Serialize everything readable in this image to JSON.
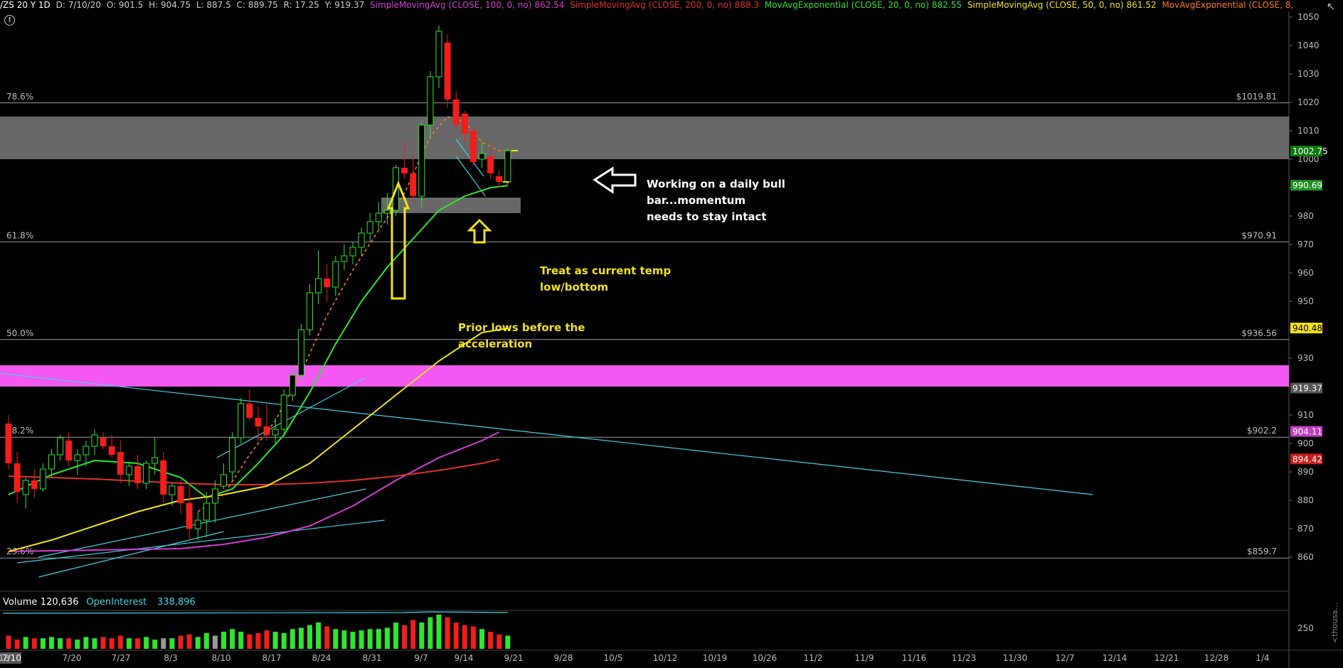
{
  "header": {
    "symbol": "/ZS 20 Y 1D",
    "fields": [
      {
        "label": "D: 7/10/20"
      },
      {
        "label": "O: 901.5"
      },
      {
        "label": "H: 904.75"
      },
      {
        "label": "L: 887.5"
      },
      {
        "label": "C: 889.75"
      },
      {
        "label": "R: 17.25"
      },
      {
        "label": "Y: 919.37"
      }
    ],
    "studies": [
      {
        "label": "SimpleMovingAvg (CLOSE, 100, 0, no)",
        "value": "862.54",
        "color": "#d43fd4"
      },
      {
        "label": "SimpleMovingAvg (CLOSE, 200, 0, no)",
        "value": "888.3",
        "color": "#e03131"
      },
      {
        "label": "MovAvgExponential (CLOSE, 20, 0, no)",
        "value": "882.55",
        "color": "#2ee62e"
      },
      {
        "label": "SimpleMovingAvg (CLOSE, 50, 0, no)",
        "value": "861.52",
        "color": "#f2e21b"
      },
      {
        "label": "MovAvgExponential (CLOSE, 8, 0,...",
        "value": "",
        "color": "#ff7a1a"
      }
    ]
  },
  "chart_data": {
    "type": "candlestick",
    "title": "/ZS 20 Y 1D",
    "x_ticks": [
      "7/10",
      "7/13",
      "7/20",
      "7/27",
      "8/3",
      "8/10",
      "8/17",
      "8/24",
      "8/31",
      "9/7",
      "9/14",
      "9/21",
      "9/28",
      "10/5",
      "10/12",
      "10/19",
      "10/26",
      "11/2",
      "11/9",
      "11/16",
      "11/23",
      "11/30",
      "12/7",
      "12/14",
      "12/21",
      "12/28",
      "1/4"
    ],
    "y_ticks": [
      860,
      870,
      880,
      890,
      900,
      910,
      920,
      930,
      940,
      950,
      960,
      970,
      980,
      990,
      1000,
      1010,
      1020,
      1030,
      1040,
      1050
    ],
    "ylim": [
      855,
      1055
    ],
    "candles": [
      [
        907,
        910,
        891,
        893
      ],
      [
        893,
        897,
        879,
        883
      ],
      [
        882,
        888,
        877,
        887
      ],
      [
        887,
        891,
        881,
        884
      ],
      [
        884,
        893,
        883,
        891
      ],
      [
        891,
        898,
        888,
        896
      ],
      [
        896,
        903,
        894,
        902
      ],
      [
        901,
        904,
        892,
        894
      ],
      [
        894,
        898,
        889,
        896
      ],
      [
        896,
        901,
        892,
        899
      ],
      [
        899,
        905,
        896,
        903
      ],
      [
        902,
        904,
        898,
        899
      ],
      [
        899,
        903,
        895,
        896
      ],
      [
        897,
        901,
        886,
        889
      ],
      [
        889,
        893,
        885,
        892
      ],
      [
        892,
        896,
        884,
        886
      ],
      [
        886,
        894,
        884,
        893
      ],
      [
        893,
        902,
        889,
        895
      ],
      [
        894,
        897,
        879,
        882
      ],
      [
        882,
        886,
        878,
        885
      ],
      [
        885,
        887,
        875,
        879
      ],
      [
        879,
        886,
        866,
        870
      ],
      [
        870,
        876,
        866,
        873
      ],
      [
        873,
        883,
        867,
        879
      ],
      [
        879,
        887,
        872,
        884
      ],
      [
        885,
        893,
        884,
        889
      ],
      [
        890,
        904,
        887,
        902
      ],
      [
        902,
        916,
        900,
        914
      ],
      [
        914,
        919,
        908,
        909
      ],
      [
        909,
        913,
        901,
        906
      ],
      [
        906,
        914,
        901,
        903
      ],
      [
        903,
        909,
        900,
        905
      ],
      [
        905,
        919,
        903,
        917
      ],
      [
        917,
        927,
        915,
        924
      ],
      [
        924,
        942,
        922,
        940
      ],
      [
        940,
        956,
        938,
        953
      ],
      [
        953,
        968,
        949,
        958
      ],
      [
        958,
        963,
        950,
        955
      ],
      [
        955,
        966,
        952,
        964
      ],
      [
        964,
        970,
        961,
        966
      ],
      [
        966,
        971,
        963,
        969
      ],
      [
        969,
        976,
        966,
        974
      ],
      [
        974,
        981,
        971,
        978
      ],
      [
        978,
        985,
        975,
        981
      ],
      [
        981,
        988,
        977,
        982
      ],
      [
        982,
        998,
        980,
        997
      ],
      [
        997,
        1006,
        993,
        995
      ],
      [
        995,
        1001,
        985,
        987
      ],
      [
        987,
        1013,
        983,
        1012
      ],
      [
        1012,
        1031,
        1007,
        1029
      ],
      [
        1029,
        1047,
        1025,
        1045
      ],
      [
        1041,
        1044,
        1018,
        1021
      ],
      [
        1021,
        1024,
        1011,
        1012
      ],
      [
        1016,
        1017,
        1006,
        1009
      ],
      [
        1010,
        1011,
        998,
        999
      ],
      [
        1000,
        1006,
        997,
        1002
      ],
      [
        1001,
        1004,
        993,
        995
      ],
      [
        994,
        996,
        990,
        992
      ],
      [
        992,
        1004,
        991,
        1003
      ]
    ],
    "series": [
      {
        "name": "SimpleMovingAvg (CLOSE, 100, 0, no)",
        "color": "#d43fd4",
        "x": [
          0,
          10,
          20,
          25,
          30,
          35,
          40,
          45,
          50,
          55,
          57
        ],
        "y": [
          862,
          862.5,
          863,
          864.5,
          867,
          871,
          878,
          887,
          895,
          901,
          904
        ]
      },
      {
        "name": "SimpleMovingAvg (CLOSE, 200, 0, no)",
        "color": "#e03131",
        "x": [
          0,
          10,
          20,
          25,
          30,
          35,
          40,
          45,
          50,
          55,
          57
        ],
        "y": [
          888.5,
          887.5,
          886,
          885.5,
          885.5,
          886,
          887,
          888.5,
          890.5,
          893,
          894.4
        ]
      },
      {
        "name": "MovAvgExponential (CLOSE, 20, 0, no)",
        "color": "#2ee62e",
        "x": [
          0,
          5,
          10,
          15,
          20,
          23,
          26,
          29,
          32,
          35,
          38,
          41,
          44,
          47,
          50,
          53,
          56,
          58
        ],
        "y": [
          882,
          889,
          894,
          893,
          888,
          881,
          884,
          893,
          903,
          918,
          935,
          950,
          962,
          972,
          982,
          987,
          990,
          990.7
        ]
      },
      {
        "name": "SimpleMovingAvg (CLOSE, 50, 0, no)",
        "color": "#f2e21b",
        "x": [
          0,
          5,
          10,
          15,
          20,
          25,
          30,
          35,
          40,
          45,
          50,
          55,
          58
        ],
        "y": [
          862,
          866,
          871,
          876,
          880,
          882,
          885,
          893,
          905,
          917,
          929,
          939,
          940.5
        ]
      },
      {
        "name": "MovAvgExponential (CLOSE, 8, 0,...",
        "color": "#ff7a1a",
        "dashed": true,
        "x": [
          22,
          25,
          28,
          31,
          34,
          37,
          40,
          43,
          46,
          49,
          51,
          53,
          55,
          57,
          58
        ],
        "y": [
          876,
          882,
          896,
          908,
          925,
          945,
          961,
          975,
          988,
          1008,
          1015,
          1013,
          1006,
          1003,
          1003
        ]
      }
    ],
    "fib_levels": [
      {
        "label": "78.6%",
        "price": 1019.81,
        "price_label": "$1019.81"
      },
      {
        "label": "61.8%",
        "price": 970.91,
        "price_label": "$970.91"
      },
      {
        "label": "50.0%",
        "price": 936.56,
        "price_label": "$936.56"
      },
      {
        "label": "38.2%",
        "price": 902.2,
        "price_label": "$902.2"
      },
      {
        "label": "23.6%",
        "price": 859.7,
        "price_label": "$859.7"
      }
    ],
    "zones": [
      {
        "color": "#6e6e6e",
        "from": 1000,
        "to": 1015,
        "x0": -2,
        "x1": 126
      },
      {
        "color": "#6e6e6e",
        "from": 981,
        "to": 986.5,
        "x0": 43.3,
        "x1": 59.5
      },
      {
        "color": "#ff5cff",
        "from": 920,
        "to": 927.5,
        "x0": -2,
        "x1": 126
      }
    ],
    "price_tags": [
      {
        "value": "1002.75",
        "price": 1002.75,
        "bg": "#0d7a0d",
        "fg": "#ffffff"
      },
      {
        "value": "990.69",
        "price": 990.69,
        "bg": "#1f8f1f",
        "fg": "#ffffff"
      },
      {
        "value": "940.48",
        "price": 940.48,
        "bg": "#f2e21b",
        "fg": "#000000"
      },
      {
        "value": "919.37",
        "price": 919.37,
        "bg": "#555555",
        "fg": "#ffffff"
      },
      {
        "value": "904.11",
        "price": 904.11,
        "bg": "#c13ec1",
        "fg": "#ffffff"
      },
      {
        "value": "894.42",
        "price": 894.42,
        "bg": "#c81d1d",
        "fg": "#ffffff"
      }
    ],
    "annotations": [
      {
        "lines": [
          "Working on a daily bull",
          "bar...momentum",
          "needs to stay intact"
        ],
        "color": "#ffffff",
        "x": 63.4,
        "price": 996
      },
      {
        "lines": [
          "Treat as current temp",
          "low/bottom"
        ],
        "color": "#f2e21b",
        "x": 53.2,
        "price": 965
      },
      {
        "lines": [
          "Prior lows before the",
          "acceleration"
        ],
        "color": "#f2e21b",
        "x": 45.0,
        "price": 948
      }
    ],
    "volume": {
      "labels": [
        {
          "text": "Volume",
          "value": "120,636",
          "value_color": "#ffffff"
        },
        {
          "text": "OpenInterest",
          "value": "338,896",
          "value_color": "#3fd7e6",
          "text_color": "#3fd7e6"
        }
      ],
      "y_tick": "250",
      "values": [
        10,
        7,
        9,
        8,
        8,
        9,
        8,
        8,
        7,
        9,
        8,
        9,
        8,
        10,
        8,
        8,
        9,
        7,
        8,
        8,
        10,
        11,
        9,
        12,
        10,
        13,
        15,
        13,
        11,
        12,
        14,
        13,
        12,
        15,
        16,
        18,
        20,
        17,
        15,
        14,
        13,
        14,
        15,
        15,
        16,
        20,
        18,
        22,
        20,
        24,
        26,
        24,
        20,
        18,
        17,
        15,
        13,
        11,
        10
      ],
      "up": [
        0,
        0,
        1,
        0,
        1,
        1,
        1,
        0,
        1,
        1,
        1,
        0,
        0,
        0,
        1,
        0,
        1,
        1,
        0,
        1,
        0,
        0,
        1,
        1,
        1,
        1,
        1,
        1,
        0,
        0,
        0,
        1,
        1,
        1,
        1,
        1,
        1,
        0,
        1,
        1,
        1,
        1,
        1,
        1,
        1,
        1,
        0,
        0,
        1,
        1,
        1,
        0,
        0,
        0,
        0,
        1,
        0,
        0,
        1
      ],
      "gray": [
        18,
        24
      ]
    }
  }
}
